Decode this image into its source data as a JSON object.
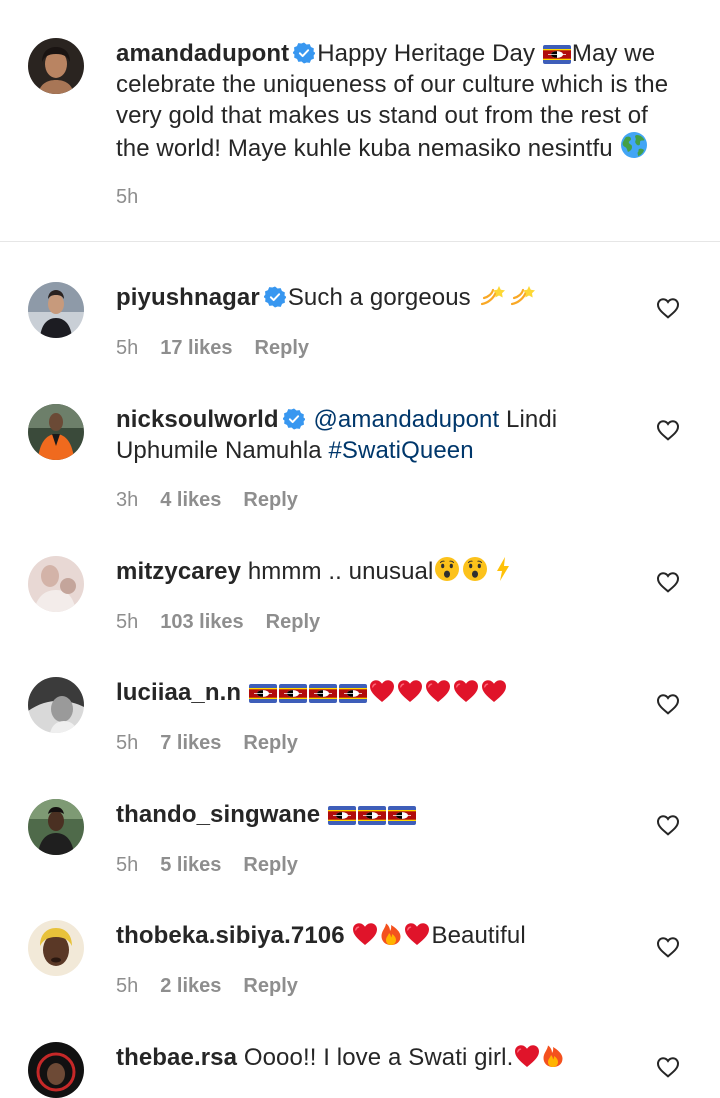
{
  "caption": {
    "username": "amandadupont",
    "verified": true,
    "text_1": "Happy Heritage Day ",
    "text_2": "May we celebrate the uniqueness of our culture which is the very gold that makes us stand out from the rest of the world! Maye kuhle kuba nemasiko nesintfu ",
    "time": "5h"
  },
  "comments": [
    {
      "username": "piyushnagar",
      "verified": true,
      "text": "Such a gorgeous ",
      "time": "5h",
      "likes": "17 likes",
      "reply": "Reply"
    },
    {
      "username": "nicksoulworld",
      "verified": true,
      "mention": "@amandadupont",
      "text": " Lindi Uphumile Namuhla ",
      "hashtag": "#SwatiQueen",
      "time": "3h",
      "likes": "4 likes",
      "reply": "Reply"
    },
    {
      "username": "mitzycarey",
      "verified": false,
      "text": "hmmm .. unusual",
      "time": "5h",
      "likes": "103 likes",
      "reply": "Reply"
    },
    {
      "username": "luciiaa_n.n",
      "verified": false,
      "text": "",
      "time": "5h",
      "likes": "7 likes",
      "reply": "Reply"
    },
    {
      "username": "thando_singwane",
      "verified": false,
      "text": "",
      "time": "5h",
      "likes": "5 likes",
      "reply": "Reply"
    },
    {
      "username": "thobeka.sibiya.7106",
      "verified": false,
      "text": "Beautiful",
      "time": "5h",
      "likes": "2 likes",
      "reply": "Reply"
    },
    {
      "username": "thebae.rsa",
      "verified": false,
      "text": "Oooo!! I love a Swati girl.",
      "time": "",
      "likes": "",
      "reply": ""
    }
  ],
  "icons": {
    "verified": "verified-badge-icon",
    "like": "heart-outline-icon",
    "flag": "eswatini-flag-emoji",
    "red_heart": "red-heart-emoji",
    "fire": "fire-emoji",
    "dizzy": "dizzy-emoji",
    "globe": "globe-emoji",
    "astonished": "hushed-face-emoji",
    "lightning": "high-voltage-emoji"
  },
  "colors": {
    "text": "#262626",
    "secondary": "#8e8e8e",
    "link": "#00376b",
    "verified": "#3897f0",
    "divider": "#e6e6e6"
  }
}
